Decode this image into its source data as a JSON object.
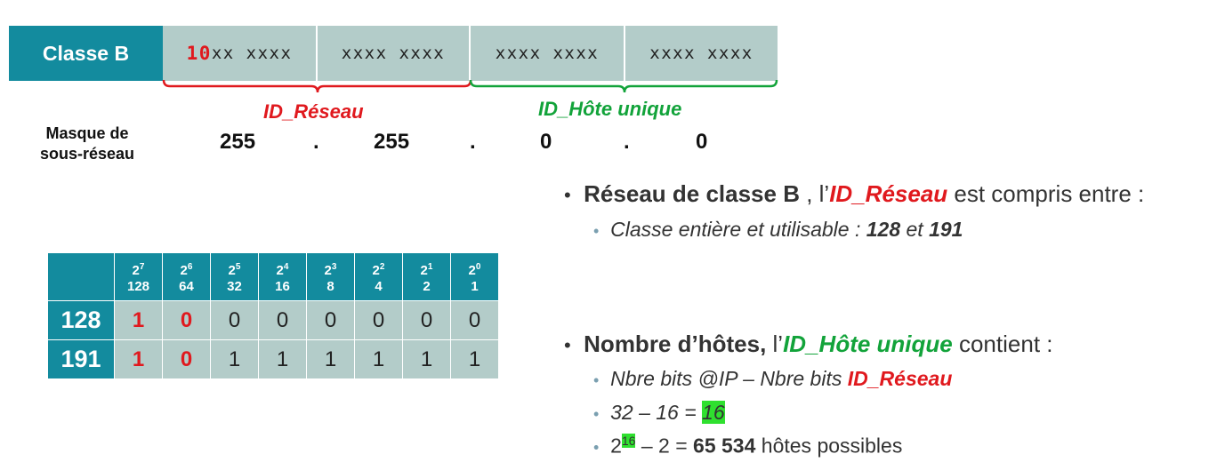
{
  "header": {
    "class_label": "Classe B",
    "octet1_prefix": "10",
    "octet1_rest": "xx xxxx",
    "octet2": "xxxx xxxx",
    "octet3": "xxxx xxxx",
    "octet4": "xxxx xxxx"
  },
  "labels": {
    "network": "ID_Réseau",
    "host": "ID_Hôte unique"
  },
  "mask": {
    "label_line1": "Masque de",
    "label_line2": "sous-réseau",
    "values": [
      "255",
      "255",
      "0",
      "0"
    ],
    "dot": "."
  },
  "bit_table": {
    "powers": [
      {
        "base": "2",
        "exp": "7",
        "value": "128"
      },
      {
        "base": "2",
        "exp": "6",
        "value": "64"
      },
      {
        "base": "2",
        "exp": "5",
        "value": "32"
      },
      {
        "base": "2",
        "exp": "4",
        "value": "16"
      },
      {
        "base": "2",
        "exp": "3",
        "value": "8"
      },
      {
        "base": "2",
        "exp": "2",
        "value": "4"
      },
      {
        "base": "2",
        "exp": "1",
        "value": "2"
      },
      {
        "base": "2",
        "exp": "0",
        "value": "1"
      }
    ],
    "rows": [
      {
        "label": "128",
        "bits": [
          "1",
          "0",
          "0",
          "0",
          "0",
          "0",
          "0",
          "0"
        ]
      },
      {
        "label": "191",
        "bits": [
          "1",
          "0",
          "1",
          "1",
          "1",
          "1",
          "1",
          "1"
        ]
      }
    ]
  },
  "bullets": {
    "b1_bold": "Réseau de classe B",
    "b1_mid": " , l’",
    "b1_red": "ID_Réseau",
    "b1_end": " est compris entre :",
    "b1_sub_text": "Classe entière et utilisable : ",
    "b1_sub_v1": "128",
    "b1_sub_and": " et ",
    "b1_sub_v2": "191",
    "b2_bold": "Nombre d’hôtes,",
    "b2_mid": " l’",
    "b2_green": "ID_Hôte unique",
    "b2_end": " contient :",
    "b2_sub1_text": "Nbre bits @IP – Nbre bits ",
    "b2_sub1_red": "ID_Réseau",
    "b2_sub2_text": "32 – 16 = ",
    "b2_sub2_hl": "16",
    "b2_sub3_base": "2",
    "b2_sub3_exp": "16",
    "b2_sub3_mid": " – 2 = ",
    "b2_sub3_bold": "65 534",
    "b2_sub3_end": " hôtes possibles"
  },
  "colors": {
    "teal": "#138b9e",
    "octet_bg": "#b3ccc9",
    "red": "#e0191e",
    "green": "#12a33a",
    "highlight": "#2fe02f"
  }
}
